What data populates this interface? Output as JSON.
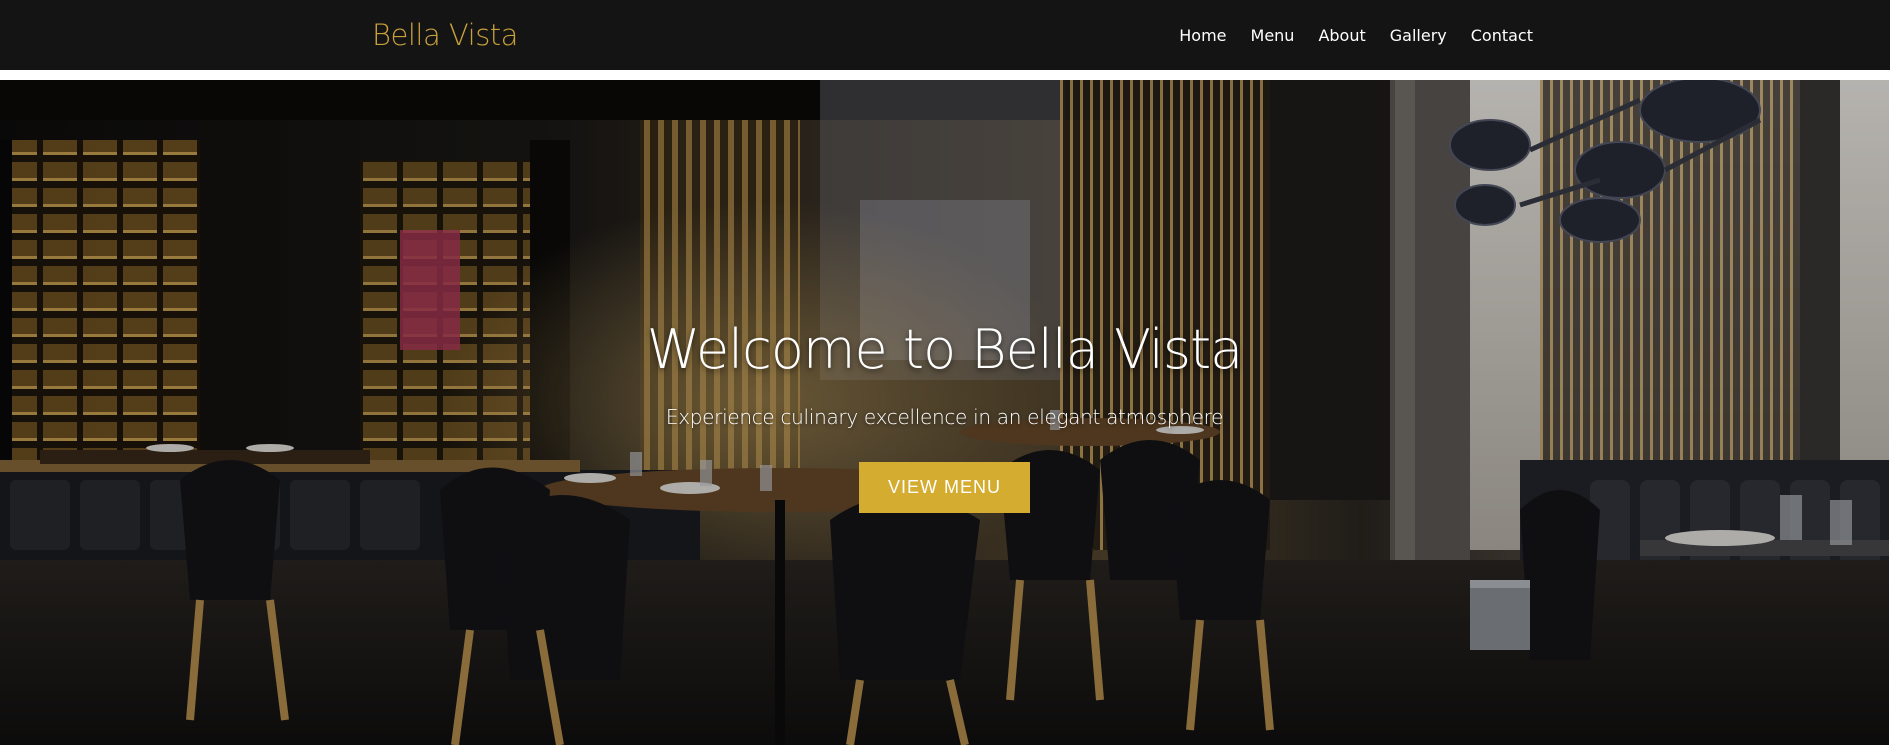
{
  "header": {
    "brand": "Bella Vista",
    "nav": [
      {
        "label": "Home"
      },
      {
        "label": "Menu"
      },
      {
        "label": "About"
      },
      {
        "label": "Gallery"
      },
      {
        "label": "Contact"
      }
    ]
  },
  "hero": {
    "title": "Welcome to Bella Vista",
    "subtitle": "Experience culinary excellence in an elegant atmosphere",
    "button_label": "VIEW MENU",
    "background_image": "restaurant-interior-photo"
  },
  "colors": {
    "nav_background": "#141414",
    "brand_gold": "#c9a13a",
    "button_gold": "#d4ac2f",
    "text_light": "#ffffff"
  }
}
